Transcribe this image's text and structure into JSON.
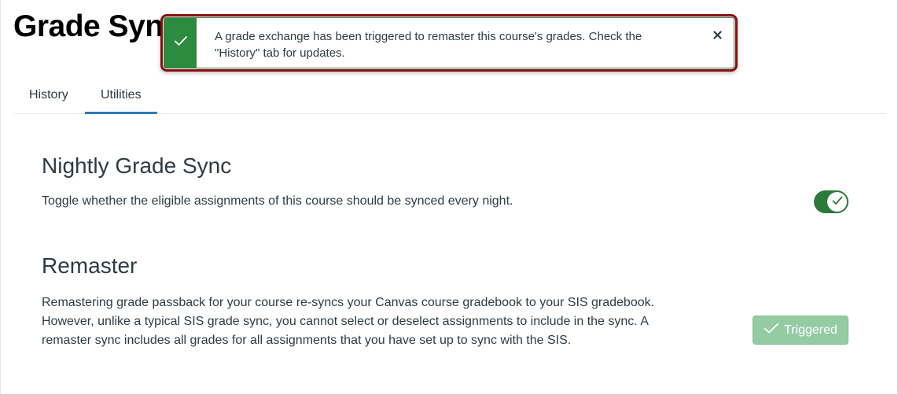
{
  "page": {
    "title": "Grade Syn"
  },
  "tabs": [
    {
      "label": "History",
      "active": false
    },
    {
      "label": "Utilities",
      "active": true
    }
  ],
  "toast": {
    "message": "A grade exchange has been triggered to remaster this course's grades. Check the \"History\" tab for updates.",
    "icon": "check-icon",
    "close_icon": "close-icon"
  },
  "nightly": {
    "title": "Nightly Grade Sync",
    "description": "Toggle whether the eligible assignments of this course should be synced every night.",
    "toggle_on": true
  },
  "remaster": {
    "title": "Remaster",
    "description": "Remastering grade passback for your course re-syncs your Canvas course gradebook to your SIS gradebook. However, unlike a typical SIS grade sync, you cannot select or deselect assignments to include in the sync. A remaster sync includes all grades for all assignments that you have set up to sync with the SIS.",
    "button_label": "Triggered"
  },
  "colors": {
    "accent": "#2b7abc",
    "success": "#2d8b3f",
    "toast_border": "#8b0d10",
    "triggered_button": "#95cba3"
  }
}
